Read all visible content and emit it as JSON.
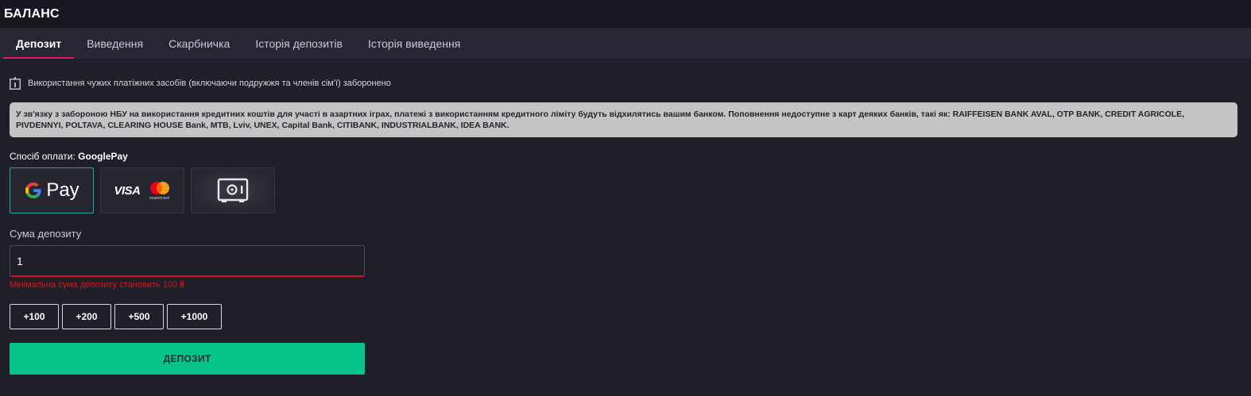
{
  "header": {
    "title": "БАЛАНС"
  },
  "tabs": [
    {
      "label": "Депозит",
      "active": true
    },
    {
      "label": "Виведення"
    },
    {
      "label": "Скарбничка"
    },
    {
      "label": "Історія депозитів"
    },
    {
      "label": "Історія виведення"
    }
  ],
  "notice": {
    "icon": "info-icon",
    "text": "Використання чужих платіжних засобів (включаючи подружжя та членів сім'ї) заборонено"
  },
  "banner": {
    "text": "У зв'язку з забороною НБУ на використання кредитних коштів для участі в азартних іграх, платежі з використанням кредитного ліміту будуть відхилятись вашим банком. Поповнення недоступне з карт деяких банків, такі як: RAIFFEISEN BANK AVAL, OTP BANK, CREDIT AGRICOLE, PIVDENNYI, POLTAVA, CLEARING HOUSE Bank, MTB, Lviv, UNEX, Capital Bank, CITIBANK, INDUSTRIALBANK, IDEA BANK."
  },
  "payment": {
    "label": "Спосіб оплати:",
    "selected": "GooglePay",
    "methods": [
      {
        "name": "googlepay",
        "text": "Pay",
        "selected": true
      },
      {
        "name": "visa-mastercard",
        "visa_text": "VISA",
        "mc_text": "mastercard"
      },
      {
        "name": "safe",
        "icon": "safe-icon"
      }
    ]
  },
  "amount": {
    "label": "Сума депозиту",
    "value": "1",
    "error": "Мінімальна сума депозиту становить 100 ₴"
  },
  "quick_amounts": [
    "+100",
    "+200",
    "+500",
    "+1000"
  ],
  "deposit_button": "ДЕПОЗИТ",
  "colors": {
    "accent": "#e2166e",
    "success": "#07c48a",
    "error": "#e0131c",
    "selected_border": "#2aa59a"
  }
}
